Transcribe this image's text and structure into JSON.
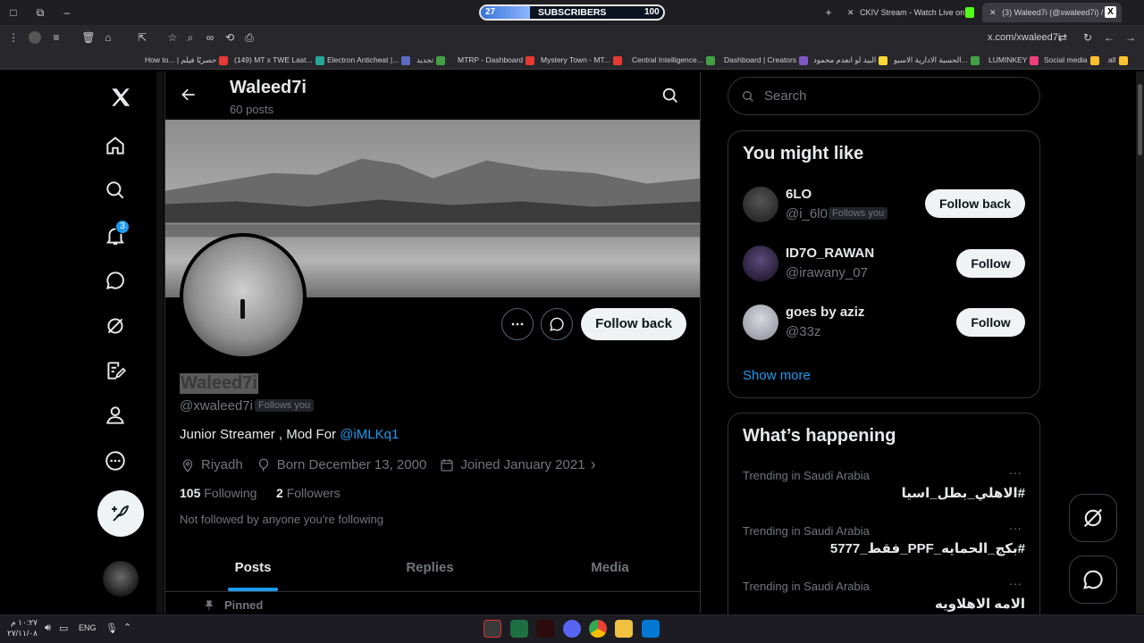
{
  "browser": {
    "stream_tab": "CKIV Stream - Watch Live on Ki",
    "x_tab": "(3) Waleed7i (@xwaleed7i) / X",
    "url": "x.com/xwaleed7i",
    "subscriber_widget": {
      "current": "27",
      "label": "SUBSCRIBERS",
      "goal": "100",
      "progress": 0.27
    },
    "bookmarks": [
      {
        "label": "How to... | حصريًا فيلم",
        "color": "#e53935"
      },
      {
        "label": "(149) MT x TWE Last...",
        "color": "#26a69a"
      },
      {
        "label": "Electron Anticheat |...",
        "color": "#5c6bc0"
      },
      {
        "label": "تجديد",
        "color": "#43a047"
      },
      {
        "label": "MTRP - Dashboard",
        "color": "#e53935"
      },
      {
        "label": "Mystery Town - MT...",
        "color": "#e53935"
      },
      {
        "label": "Central Intelligence...",
        "color": "#43a047"
      },
      {
        "label": "Dashboard | Creators",
        "color": "#7e57c2"
      },
      {
        "label": "البيد لو انعدم محمود",
        "color": "#fdd835"
      },
      {
        "label": "الحسبة الادارية الاسبو...",
        "color": "#43a047"
      },
      {
        "label": "LUMINKEY",
        "color": "#ec407a"
      },
      {
        "label": "Social media",
        "color": "#fbc02d"
      },
      {
        "label": "all",
        "color": "#fbc02d"
      }
    ]
  },
  "nav": {
    "notifications_count": "3"
  },
  "header": {
    "name": "Waleed7i",
    "post_count": "60 posts"
  },
  "profile": {
    "display_name": "Waleed7i",
    "handle": "@xwaleed7i",
    "follows_you": "Follows you",
    "bio_text": "Junior Streamer , Mod For ",
    "bio_mention": "@iMLKq1",
    "location": "Riyadh",
    "birthday": "Born December 13, 2000",
    "joined": "Joined January 2021",
    "following_count": "105",
    "following_label": "Following",
    "followers_count": "2",
    "followers_label": "Followers",
    "not_followed_note": "Not followed by anyone you're following",
    "follow_back_label": "Follow back"
  },
  "tabs": [
    {
      "label": "Posts",
      "active": true
    },
    {
      "label": "Replies",
      "active": false
    },
    {
      "label": "Media",
      "active": false
    }
  ],
  "pinned_label": "Pinned",
  "search": {
    "placeholder": "Search"
  },
  "who_to_follow": {
    "title": "You might like",
    "users": [
      {
        "name": "6LO",
        "handle": "@i_6l0",
        "badge": "Follows you",
        "button": "Follow back"
      },
      {
        "name": "ID7O_RAWAN",
        "handle": "@irawany_07",
        "badge": "",
        "button": "Follow"
      },
      {
        "name": "goes by aziz",
        "handle": "@33z",
        "badge": "",
        "button": "Follow"
      }
    ],
    "show_more": "Show more"
  },
  "trends": {
    "title": "What’s happening",
    "items": [
      {
        "category": "Trending in Saudi Arabia",
        "name": "#الاهلي_بطل_اسيا"
      },
      {
        "category": "Trending in Saudi Arabia",
        "name": "#بكج_الحمايه_PPF_فقط_5777"
      },
      {
        "category": "Trending in Saudi Arabia",
        "name": "الامه الاهلاويه"
      }
    ]
  },
  "taskbar": {
    "time": "١٠:٢٧ م",
    "date": "٢٧/١١/٠٨",
    "lang": "ENG"
  },
  "colors": {
    "accent": "#1d9bf0",
    "badge": "#1d9bf0"
  }
}
